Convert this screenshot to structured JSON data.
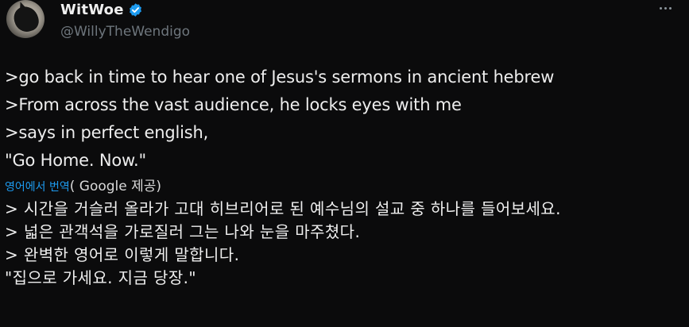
{
  "author": {
    "display_name": "WitWoe",
    "handle": "@WillyTheWendigo",
    "verified": true
  },
  "tweet": {
    "lines": [
      ">go back in time to hear one of Jesus's sermons in ancient hebrew",
      ">From across the vast audience, he locks eyes with me",
      ">says in perfect english,",
      "\"Go Home. Now.\""
    ],
    "translate": {
      "link_label": "영어에서 번역",
      "provider_label": "( Google 제공)"
    },
    "translated_lines": [
      "> 시간을 거슬러 올라가 고대 히브리어로 된 예수님의 설교 중 하나를 들어보세요.",
      "> 넓은 관객석을 가로질러 그는 나와 눈을 마주쳤다.",
      "> 완벽한 영어로 이렇게 말합니다.",
      "\"집으로 가세요. 지금 당장.\""
    ]
  },
  "icons": {
    "verified": "verified-badge-icon",
    "more": "more-options-icon",
    "avatar": "avatar-image"
  },
  "colors": {
    "background": "#0b0b0c",
    "text": "#eeeeee",
    "handle": "#6e767d",
    "link": "#1d9bf0",
    "verified": "#1d9bf0"
  }
}
